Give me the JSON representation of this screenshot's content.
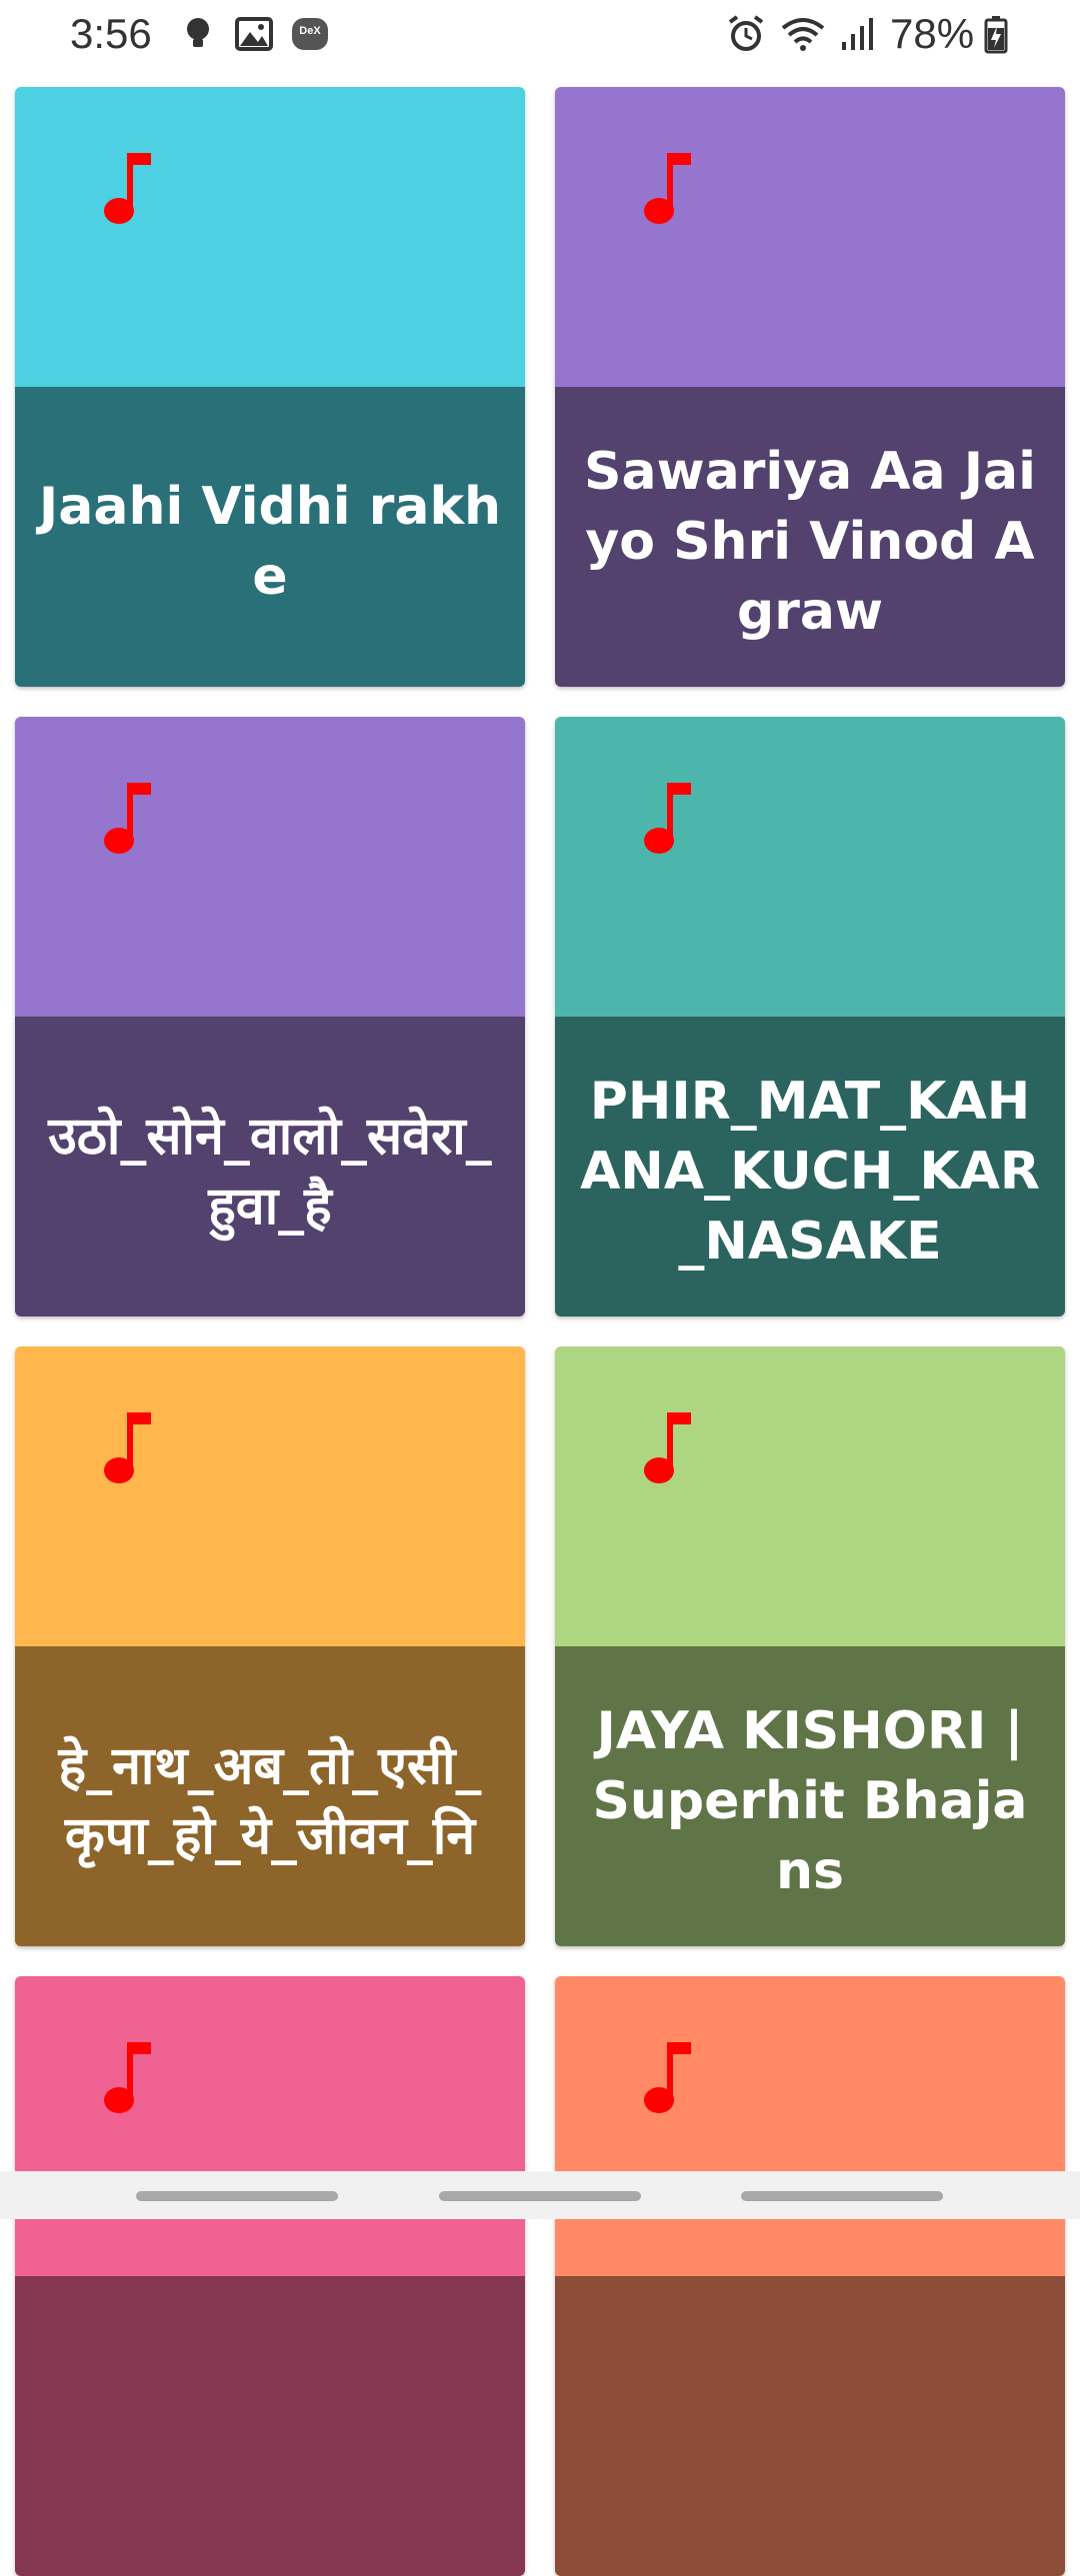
{
  "status_bar": {
    "time": "3:56",
    "battery": "78%",
    "icons": [
      "bulb-icon",
      "image-icon",
      "dex-icon",
      "alarm-icon",
      "wifi-icon",
      "signal-icon",
      "battery-icon"
    ],
    "dex_label": "DeX"
  },
  "cards": [
    {
      "title": "Jaahi Vidhi rakhe",
      "top_color": "#4dd0e1",
      "bottom_color": "#2a7079"
    },
    {
      "title": "Sawariya Aa Jaiyo  Shri Vinod Agraw",
      "top_color": "#9575cd",
      "bottom_color": "#53416e"
    },
    {
      "title": "उठो_सोने_वालो_सवेरा_हुवा_है",
      "top_color": "#9575cd",
      "bottom_color": "#53416e"
    },
    {
      "title": "PHIR_MAT_KAHANA_KUCH_KAR_NASAKE",
      "top_color": "#4db6ac",
      "bottom_color": "#2b645f"
    },
    {
      "title": "हे_नाथ_अब_तो_एसी_कृपा_हो_ये_जीवन_नि",
      "top_color": "#ffb74d",
      "bottom_color": "#8d642a"
    },
    {
      "title": "JAYA KISHORI | Superhit Bhajans",
      "top_color": "#aed581",
      "bottom_color": "#607547"
    },
    {
      "title": "",
      "top_color": "#f06292",
      "bottom_color": "#853651"
    },
    {
      "title": "",
      "top_color": "#ff8a65",
      "bottom_color": "#8d4c38"
    }
  ],
  "icon_color": "#ff0000"
}
